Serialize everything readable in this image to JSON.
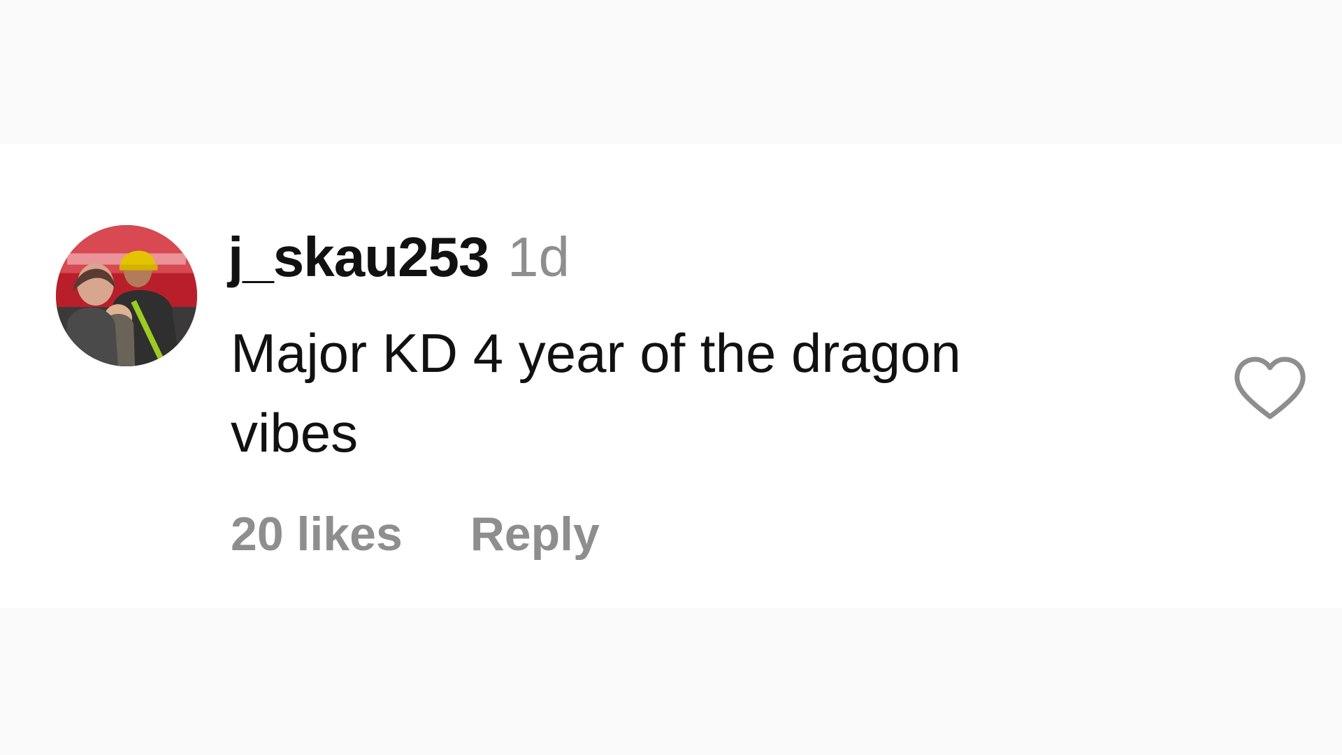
{
  "comment": {
    "username": "j_skau253",
    "time": "1d",
    "text": "Major KD 4 year of the dragon vibes",
    "likes": "20 likes",
    "reply_label": "Reply",
    "avatar_icon": "user-avatar-photo",
    "like_icon": "heart-outline-icon"
  },
  "colors": {
    "page_background": "#fafafa",
    "card_background": "#ffffff",
    "primary_text": "#111111",
    "secondary_text": "#8e8e8e"
  }
}
